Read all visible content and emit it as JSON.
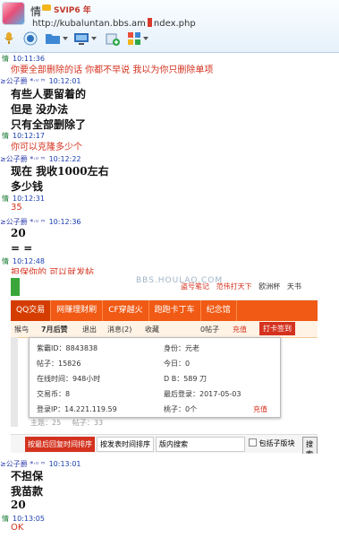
{
  "header": {
    "username": "情",
    "vip_label": "SVIP6 年",
    "url": "http://kubaluntan.bbs.am",
    "url_tail": "ndex.php"
  },
  "toolbar": {
    "icons": [
      "mic-icon",
      "camera-icon",
      "folder-icon",
      "screen-icon",
      "add-app-icon",
      "apps-grid-icon"
    ]
  },
  "chat": {
    "sender_a": "情",
    "sender_b": "≥公子爵",
    "b_suffix": "*·ᵘ ᵐ",
    "messages": [
      {
        "who": "a",
        "time": "10:11:36",
        "lines": [
          "你要全部删除的话  你都不早说  我以为你只删除单项"
        ],
        "style": "red"
      },
      {
        "who": "b",
        "time": "10:12:01",
        "lines": [
          "有些人要留着的",
          "但是  没办法",
          "只有全部删除了"
        ],
        "style": "bold"
      },
      {
        "who": "a",
        "time": "10:12:17",
        "lines": [
          "你可以克隆多少个"
        ],
        "style": "red"
      },
      {
        "who": "b",
        "time": "10:12:22",
        "lines": [
          "现在  我收1000左右",
          "多少钱"
        ],
        "style": "bold"
      },
      {
        "who": "a",
        "time": "10:12:31",
        "lines": [
          "35"
        ],
        "style": "red"
      },
      {
        "who": "b",
        "time": "10:12:36",
        "lines": [
          "20",
          "=  ="
        ],
        "style": "bold"
      },
      {
        "who": "a",
        "time": "10:12:48",
        "lines": [
          "担保你的     可以就发帖"
        ],
        "style": "red"
      },
      {
        "who": "b",
        "time": "10:13:01",
        "lines": [
          "不担保",
          "我苗款",
          "20"
        ],
        "style": "bold"
      },
      {
        "who": "a",
        "time": "10:13:05",
        "lines": [
          "OK"
        ],
        "style": "red"
      }
    ]
  },
  "screenshot": {
    "watermark": "BBS.HOULAO.COM",
    "top_links": [
      "盗号笔记",
      "范伟打天下",
      "欧洲杯",
      "天书"
    ],
    "nav": [
      "QQ交易",
      "网赚理财刷",
      "CF穿越火",
      "跑跑卡丁车",
      "纪念馆"
    ],
    "sub": [
      "猴鸟",
      "7月后赞",
      "退出",
      "消息(2)",
      "收藏",
      "0帖子",
      "充值",
      "打卡签到"
    ],
    "popup": {
      "left": [
        "紫霸ID：8843838",
        "帖子：15826",
        "在线时间：948小时",
        "交易币：8",
        "登录IP：14.221.119.59"
      ],
      "right": [
        "身份：元老",
        "今日：0",
        "D B：589 刀",
        "最后登录：2017-05-03",
        "桃子：0个"
      ],
      "action": "充值"
    },
    "stats": "主题：25     帖子：33",
    "bottom": [
      "按最后回复时间排序",
      "按发表时间排序",
      "版内搜索",
      "包括子版块",
      "搜索"
    ]
  }
}
